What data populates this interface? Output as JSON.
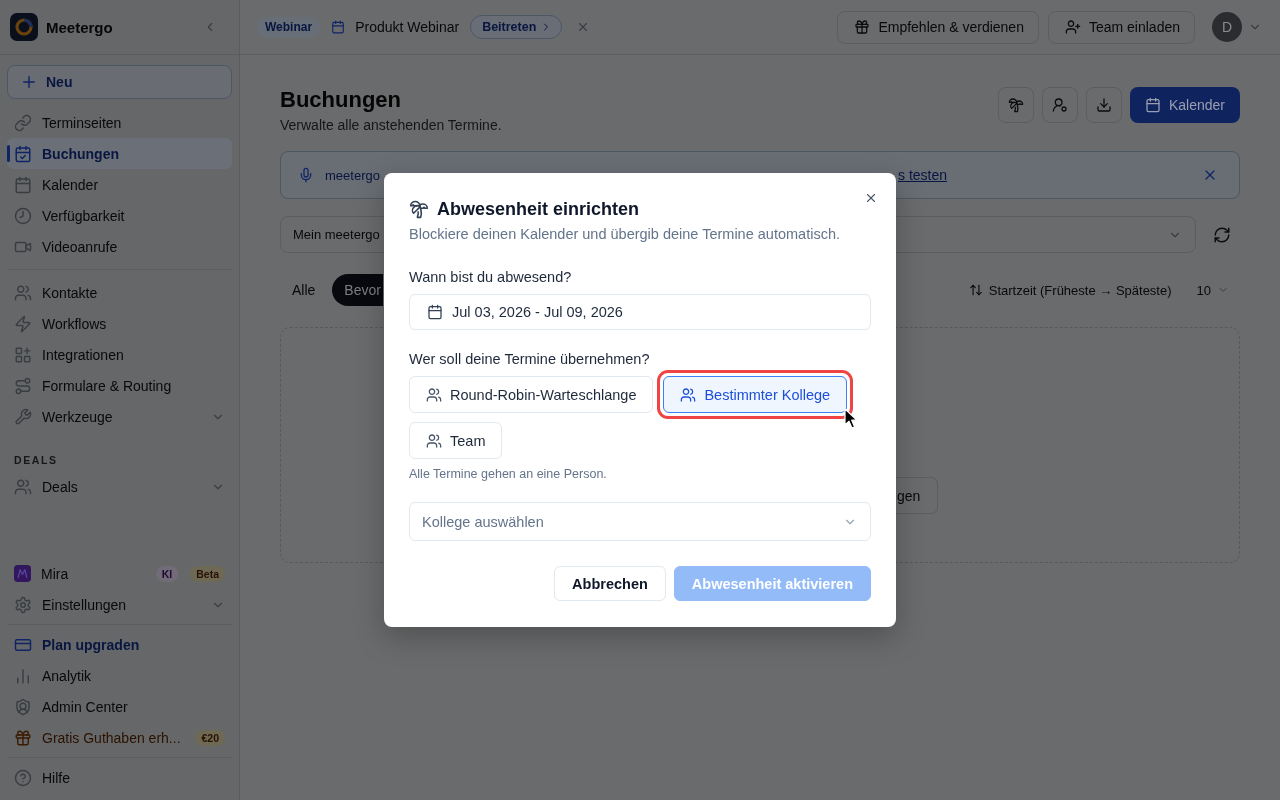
{
  "sidebar": {
    "brand": "Meetergo",
    "new_button": "Neu",
    "sections": [
      {
        "items": [
          {
            "label": "Terminseiten",
            "selected": false
          },
          {
            "label": "Buchungen",
            "selected": true
          },
          {
            "label": "Kalender",
            "selected": false
          },
          {
            "label": "Verfügbarkeit",
            "selected": false
          },
          {
            "label": "Videoanrufe",
            "selected": false
          }
        ]
      },
      {
        "items": [
          {
            "label": "Kontakte",
            "selected": false
          },
          {
            "label": "Workflows",
            "selected": false
          },
          {
            "label": "Integrationen",
            "selected": false
          },
          {
            "label": "Formulare & Routing",
            "selected": false
          },
          {
            "label": "Werkzeuge",
            "selected": false,
            "expanded": false
          }
        ]
      },
      {
        "title": "DEALS",
        "items": [
          {
            "label": "Deals",
            "selected": false,
            "expanded": false
          }
        ]
      }
    ],
    "footer_sections": [
      {
        "items": [
          {
            "label": "Mira",
            "kind": "default",
            "selected": false,
            "badges": [
              {
                "text": "KI",
                "kind": "ai"
              },
              {
                "text": "Beta",
                "kind": "beta"
              }
            ]
          },
          {
            "label": "Einstellungen",
            "kind": "default",
            "selected": false,
            "expanded": false
          }
        ]
      },
      {
        "items": [
          {
            "label": "Plan upgraden",
            "kind": "upgrade",
            "selected": false
          },
          {
            "label": "Analytik",
            "kind": "default",
            "selected": false
          },
          {
            "label": "Admin Center",
            "kind": "default",
            "selected": false
          },
          {
            "label": "Gratis Guthaben erh...",
            "kind": "promo",
            "selected": false,
            "badges": [
              {
                "text": "€20",
                "kind": "credit"
              }
            ]
          }
        ]
      },
      {
        "items": [
          {
            "label": "Hilfe",
            "kind": "default",
            "selected": false
          }
        ]
      }
    ]
  },
  "top_bar": {
    "event": {
      "badge": "Webinar",
      "title": "Produkt Webinar",
      "join_button": "Beitreten"
    },
    "buttons": [
      "Empfehlen & verdienen",
      "Team einladen"
    ],
    "avatar": "D"
  },
  "page": {
    "title": "Buchungen",
    "subtitle": "Verwalte alle anstehenden Termine.",
    "calendar_button": "Kalender",
    "banner": {
      "text": "meetergo",
      "link": "s testen"
    },
    "calendar_select": {
      "value": "Mein meetergo"
    },
    "tabs": [
      {
        "label": "Alle",
        "selected": false
      },
      {
        "label": "Bevor",
        "selected": true
      }
    ],
    "sort": "Startzeit (Früheste → Späteste)",
    "page_size": "10",
    "empty_state_button": "gen"
  },
  "dialog": {
    "title": "Abwesenheit einrichten",
    "subtitle": "Blockiere deinen Kalender und übergib deine Termine automatisch.",
    "date_label": "Wann bist du abwesend?",
    "date_range": "Jul 03, 2026 - Jul 09, 2026",
    "handover_label": "Wer soll deine Termine übernehmen?",
    "options": [
      {
        "label": "Round-Robin-Warteschlange",
        "selected": false,
        "highlighted": false
      },
      {
        "label": "Bestimmter Kollege",
        "selected": true,
        "highlighted": true
      },
      {
        "label": "Team",
        "selected": false,
        "highlighted": false
      }
    ],
    "hint": "Alle Termine gehen an eine Person.",
    "colleague_select": {
      "placeholder": "Kollege auswählen"
    },
    "buttons": [
      {
        "label": "Abbrechen",
        "kind": "secondary",
        "disabled": false
      },
      {
        "label": "Abwesenheit aktivieren",
        "kind": "primary",
        "disabled": true
      }
    ]
  }
}
